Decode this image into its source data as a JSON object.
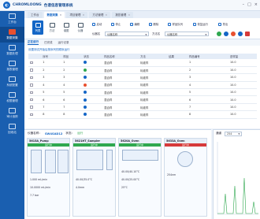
{
  "app": {
    "brand": "CHROMLOONG",
    "name": "色谱信息管理系统"
  },
  "sidebar": {
    "items": [
      {
        "label": "工作台"
      },
      {
        "label": "数据采集"
      },
      {
        "label": "数据处理"
      },
      {
        "label": "报表管理"
      },
      {
        "label": "系统配置"
      },
      {
        "label": "权限管理"
      },
      {
        "label": "审计追踪"
      },
      {
        "label": "回收站"
      }
    ]
  },
  "tabs": [
    {
      "label": "工作台"
    },
    {
      "label": "数据采集"
    },
    {
      "label": "项目管理"
    },
    {
      "label": "方法管理"
    },
    {
      "label": "报告管理"
    }
  ],
  "toolbar": {
    "views": [
      {
        "label": "列表"
      },
      {
        "label": "方法"
      },
      {
        "label": "谱图"
      },
      {
        "label": "仪器"
      }
    ],
    "start": "启动",
    "stop": "停止",
    "edit": "编辑",
    "delete": "删除",
    "queue": "样品队列",
    "resume": "恢复运行",
    "export": "导出",
    "instrument_label": "仪器名",
    "instrument_value": "仪器名称",
    "method_label": "方法名",
    "method_value": "仪器名称"
  },
  "subtabs": [
    "正在运行",
    "已完成",
    "运行记录"
  ],
  "hint": "设置测试开始后按序列的顺序运行",
  "table": {
    "headers": [
      "",
      "序号",
      "样品",
      "状态",
      "样品名称",
      "方法",
      "结果",
      "样品编号",
      "",
      "进样量"
    ],
    "rows": [
      [
        "",
        "1",
        "1",
        "",
        "混合样",
        "标准样",
        "",
        "1",
        "",
        "10.0"
      ],
      [
        "",
        "2",
        "2",
        "",
        "混合样",
        "标准样",
        "",
        "2",
        "",
        "10.0"
      ],
      [
        "",
        "3",
        "3",
        "",
        "混合样",
        "标准样",
        "",
        "3",
        "",
        "10.0"
      ],
      [
        "",
        "4",
        "4",
        "",
        "混合样",
        "标准样",
        "",
        "4",
        "",
        "10.0"
      ],
      [
        "",
        "5",
        "5",
        "",
        "混合样",
        "标准样",
        "",
        "5",
        "",
        "10.0"
      ],
      [
        "",
        "6",
        "6",
        "",
        "混合样",
        "标准样",
        "",
        "6",
        "",
        "10.0"
      ],
      [
        "",
        "7",
        "7",
        "",
        "混合样",
        "标准样",
        "",
        "7",
        "",
        "10.0"
      ],
      [
        "",
        "8",
        "8",
        "",
        "混合样",
        "标准样",
        "",
        "8",
        "",
        "10.0"
      ]
    ],
    "status_colors": [
      "#1466c6",
      "#2fa84f",
      "#1466c6",
      "#e8502f",
      "#1466c6",
      "#1466c6",
      "#1466c6",
      "#1466c6"
    ]
  },
  "instrument": {
    "label": "仪器名称：",
    "value": "SW4SAD12",
    "state_label": "状态：",
    "state": "运行"
  },
  "modules": [
    {
      "name": "5615A_Pump",
      "status": "运行中",
      "l1": "1.000 mL/min",
      "l2": "10.0000 mL/min",
      "l3": "7.7 bar"
    },
    {
      "name": "5621HT_Sampler",
      "status": "运行中",
      "l1": "40.00/35.0°C",
      "l2": "4.0mm",
      "l3": ""
    },
    {
      "name": "5620A_Oven",
      "status": "运行中",
      "l1": "40.00/40.10°C",
      "l2": "40.00/25.00°C",
      "l3": "25°C"
    },
    {
      "name": "5633A_Oven",
      "status": "运行中",
      "l1": "254nm",
      "l2": "",
      "l3": ""
    }
  ],
  "chart": {
    "label": "通道",
    "value": "254"
  },
  "colors": {
    "primary": "#1466c6",
    "sidebar": "#1a5fb0",
    "running": "#2fa84f",
    "alert": "#d63a3a"
  }
}
